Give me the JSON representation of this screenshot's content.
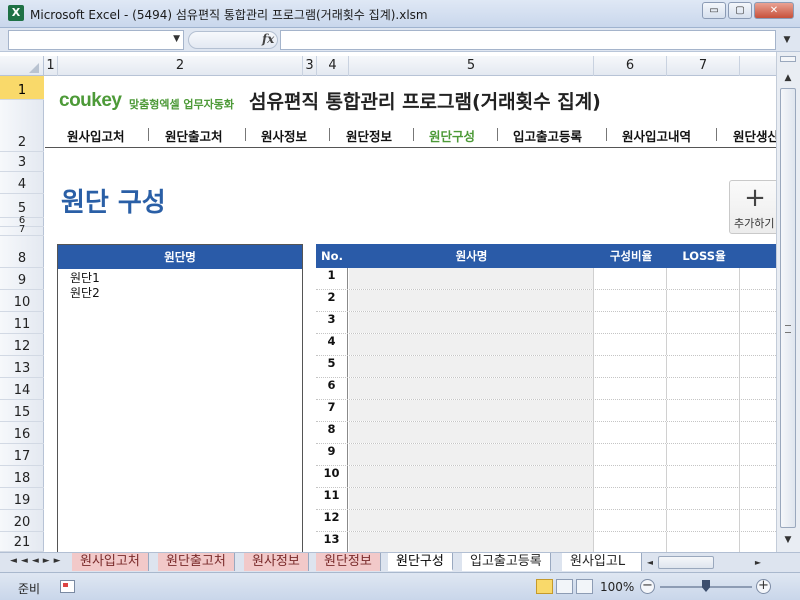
{
  "window": {
    "title": "Microsoft Excel - (5494) 섬유편직 통합관리 프로그램(거래횟수 집계).xlsm",
    "app_icon": "X",
    "minimize": "▭",
    "restore": "▢",
    "close": "✕"
  },
  "formula_bar": {
    "name_box": "",
    "fx": "fx",
    "formula": ""
  },
  "column_headers": [
    "1",
    "2",
    "3",
    "4",
    "5",
    "6",
    "7"
  ],
  "row_headers": [
    "1",
    "2",
    "3",
    "4",
    "5",
    "6",
    "7",
    "8",
    "9",
    "10",
    "11",
    "12",
    "13",
    "14",
    "15",
    "16",
    "17",
    "18",
    "19",
    "20",
    "21"
  ],
  "brand": {
    "logo": "coukey",
    "tagline": "맞춤형엑셀 업무자동화",
    "app_title": "섬유편직 통합관리 프로그램(거래횟수 집계)"
  },
  "menu": {
    "items": [
      "원사입고처",
      "원단출고처",
      "원사정보",
      "원단정보",
      "원단구성",
      "입고출고등록",
      "원사입고내역",
      "원단생산"
    ],
    "current": "원단구성"
  },
  "page": {
    "heading": "원단 구성",
    "add_button": {
      "icon": "+",
      "label": "추가하기"
    }
  },
  "fabric_list": {
    "header": "원단명",
    "items": [
      "원단1",
      "원단2"
    ]
  },
  "composition_table": {
    "headers": [
      "No.",
      "원사명",
      "구성비율",
      "LOSS율"
    ],
    "row_numbers": [
      "1",
      "2",
      "3",
      "4",
      "5",
      "6",
      "7",
      "8",
      "9",
      "10",
      "11",
      "12",
      "13"
    ]
  },
  "sheet_tabs": {
    "nav": "◄◄◄►►",
    "tabs": [
      "원사입고처",
      "원단출고처",
      "원사정보",
      "원단정보",
      "원단구성",
      "입고출고등록",
      "원사입고L"
    ],
    "active": "원단구성"
  },
  "status_bar": {
    "ready": "준비",
    "zoom": "100%",
    "zoom_minus": "−",
    "zoom_plus": "+"
  },
  "colors": {
    "header_blue": "#2a5ba8",
    "brand_green": "#4d9a38",
    "heading_blue": "#2a5fa6",
    "active_row_header": "#f9d96a",
    "tab_pink": "#f2c9c9"
  }
}
